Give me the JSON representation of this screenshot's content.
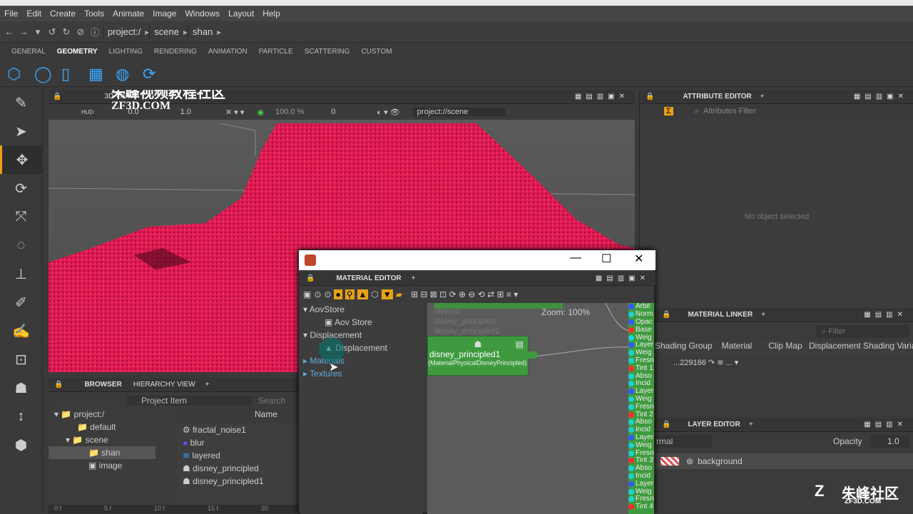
{
  "menu": [
    "File",
    "Edit",
    "Create",
    "Tools",
    "Animate",
    "Image",
    "Windows",
    "Layout",
    "Help"
  ],
  "path": {
    "crumbs": [
      "project:/",
      "scene",
      "shan"
    ]
  },
  "shelf_tabs": [
    "GENERAL",
    "GEOMETRY",
    "LIGHTING",
    "RENDERING",
    "ANIMATION",
    "PARTICLE",
    "SCATTERING",
    "CUSTOM"
  ],
  "shelf_active": "GEOMETRY",
  "viewport": {
    "title": "3D VIEW",
    "hud": "HUD",
    "fields": [
      "0.0",
      "1.0",
      "100.0 %",
      "0"
    ],
    "path": "project://scene"
  },
  "watermark": {
    "cn": "朱峰视频教程社区",
    "en": "ZF3D.COM",
    "cn2": "朱峰社区",
    "en2": "ZF3D.COM"
  },
  "attribute_editor": {
    "title": "ATTRIBUTE EDITOR",
    "filter_placeholder": "Attributes Filter",
    "empty": "No object selected"
  },
  "browser": {
    "tabs": [
      "BROWSER",
      "HIERARCHY VIEW"
    ],
    "dropdown": "Project Item",
    "search_placeholder": "Search",
    "col": "Name",
    "tree": [
      "project:/",
      "default",
      "scene",
      "shan",
      "image"
    ],
    "items": [
      "fractal_noise1",
      "blur",
      "layered",
      "disney_principled",
      "disney_principled1"
    ]
  },
  "material_editor": {
    "title": "MATERIAL EDITOR",
    "tree": [
      "AovStore",
      "Aov Store",
      "Displacement",
      "Displacement",
      "Materials",
      "Textures"
    ],
    "zoom": "Zoom: 100%",
    "ghost_nodes": [
      "layered",
      "disney_principled",
      "disney_principled1"
    ],
    "node_title": "disney_principled1",
    "node_sub": "(MaterialPhysicalDisneyPrincipled)",
    "pins": [
      "Arbit",
      "Norm",
      "Opac",
      "Base",
      "Weig",
      "Layer",
      "Weig",
      "Fresn",
      "Tint 1",
      "Abso",
      "Incid",
      "Layer",
      "Weig",
      "Fresn",
      "Tint 2",
      "Abso",
      "Incid",
      "Layer",
      "Weig",
      "Fresn",
      "Tint 3",
      "Abso",
      "Incid",
      "Layer",
      "Weig",
      "Fresn",
      "Tint 4"
    ],
    "pin_colors": [
      "#2d5cff",
      "#19d3d3",
      "#2d5cff",
      "#ff2a2a",
      "#19d3d3",
      "#2d5cff",
      "#19d3d3",
      "#19d3d3",
      "#ff2a2a",
      "#19d3d3",
      "#19d3d3",
      "#2d5cff",
      "#19d3d3",
      "#19d3d3",
      "#ff2a2a",
      "#19d3d3",
      "#19d3d3",
      "#2d5cff",
      "#19d3d3",
      "#19d3d3",
      "#ff2a2a",
      "#19d3d3",
      "#19d3d3",
      "#2d5cff",
      "#19d3d3",
      "#19d3d3",
      "#ff2a2a"
    ]
  },
  "material_linker": {
    "title": "MATERIAL LINKER",
    "filter_placeholder": "Filter",
    "cols": [
      "Shading Group",
      "Material",
      "Clip Map",
      "Displacement",
      "Shading Variab"
    ],
    "row_id": "...229166"
  },
  "layer_editor": {
    "title": "LAYER EDITOR",
    "mode": "rmal",
    "opacity_label": "Opacity",
    "opacity": "1.0",
    "layer": "background"
  },
  "timeline": {
    "ticks": [
      "0 f",
      "5 f",
      "10 f",
      "15 f",
      "20"
    ]
  }
}
